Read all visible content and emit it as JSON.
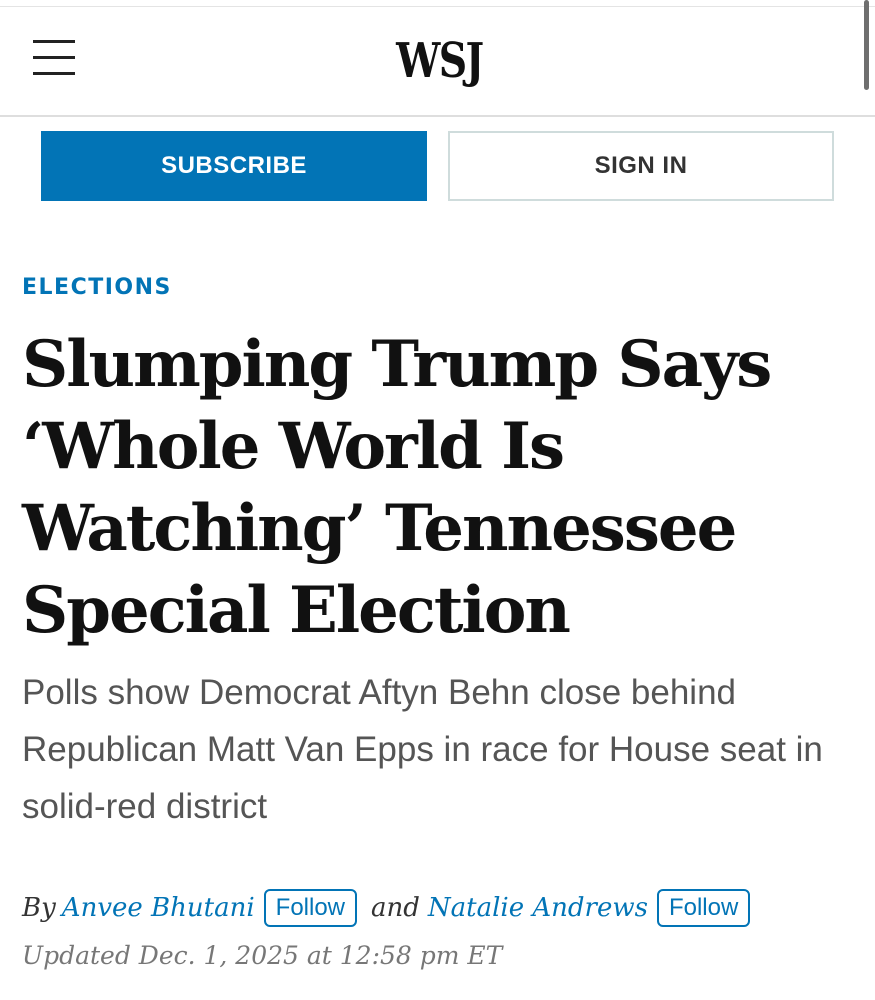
{
  "header": {
    "logo_text": "WSJ",
    "menu_icon": "hamburger-menu-icon"
  },
  "actions": {
    "subscribe_label": "SUBSCRIBE",
    "signin_label": "SIGN IN"
  },
  "article": {
    "section": "ELECTIONS",
    "headline": "Slumping Trump Says ‘Whole World Is Watching’ Tennessee Special Election",
    "dek": "Polls show Democrat Aftyn Behn close behind Republican Matt Van Epps in race for House seat in solid-red district",
    "byline": {
      "prefix": "By",
      "authors": [
        {
          "name": "Anvee Bhutani",
          "follow_label": "Follow"
        },
        {
          "name": "Natalie Andrews",
          "follow_label": "Follow"
        }
      ],
      "conjunction": "and"
    },
    "updated": "Updated Dec. 1, 2025 at 12:58 pm ET"
  },
  "colors": {
    "accent": "#0274b6",
    "headline": "#111111",
    "dek": "#555555",
    "timestamp": "#777777"
  }
}
